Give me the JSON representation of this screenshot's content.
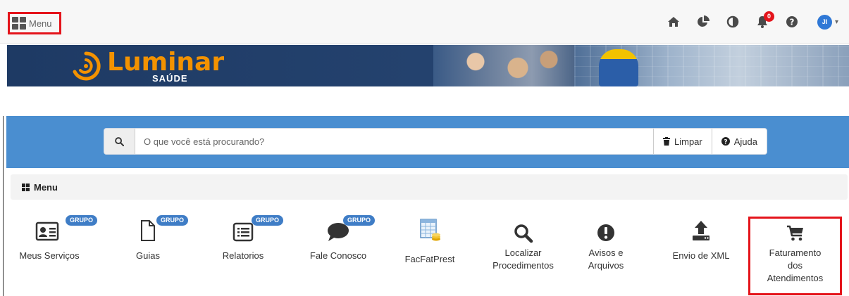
{
  "topbar": {
    "menu_label": "Menu",
    "notification_count": "0",
    "user_initials": "JI",
    "icons": [
      "home-icon",
      "pie-chart-icon",
      "contrast-icon",
      "bell-icon",
      "help-icon",
      "user-avatar"
    ]
  },
  "banner": {
    "brand_name": "Luminar",
    "brand_sub": "SAÚDE"
  },
  "search": {
    "placeholder": "O que você está procurando?",
    "clear_label": "Limpar",
    "help_label": "Ajuda"
  },
  "menu": {
    "header": "Menu",
    "items": [
      {
        "label": "Meus Serviços",
        "badge": "GRUPO",
        "icon": "id-card-icon"
      },
      {
        "label": "Guias",
        "badge": "GRUPO",
        "icon": "file-icon"
      },
      {
        "label": "Relatorios",
        "badge": "GRUPO",
        "icon": "list-alt-icon"
      },
      {
        "label": "Fale Conosco",
        "badge": "GRUPO",
        "icon": "comment-icon"
      },
      {
        "label": "FacFatPrest",
        "badge": "",
        "icon": "spreadsheet-coins-icon"
      },
      {
        "label_lines": [
          "Localizar",
          "Procedimentos"
        ],
        "badge": "",
        "icon": "search-icon"
      },
      {
        "label_lines": [
          "Avisos e",
          "Arquivos"
        ],
        "badge": "",
        "icon": "exclamation-icon"
      },
      {
        "label": "Envio de XML",
        "badge": "",
        "icon": "upload-icon"
      },
      {
        "label_lines": [
          "Faturamento",
          "dos",
          "Atendimentos"
        ],
        "badge": "",
        "icon": "cart-icon"
      }
    ]
  },
  "colors": {
    "search_panel": "#4a8ed0",
    "badge_blue": "#3f7dc6",
    "highlight_red": "#e4141b",
    "brand_orange": "#f39200",
    "banner_navy": "#1e3a64"
  }
}
